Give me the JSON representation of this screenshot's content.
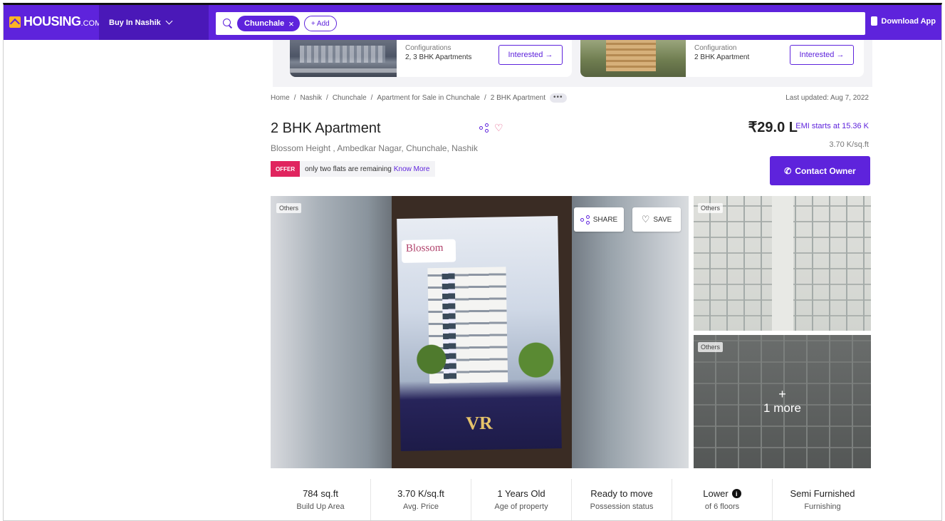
{
  "topbar": {
    "logo_text": "HOUSING",
    "logo_suffix": ".COM",
    "city_button": "Buy In Nashik",
    "search_chip": "Chunchale",
    "chip_close": "×",
    "add_button": "+ Add",
    "download_app": "Download App"
  },
  "similar_projects": [
    {
      "config_label": "Configurations",
      "config_value": "2, 3 BHK Apartments",
      "button": "Interested →"
    },
    {
      "config_label": "Configuration",
      "config_value": "2 BHK Apartment",
      "button": "Interested →"
    }
  ],
  "breadcrumb": {
    "items": [
      "Home",
      "Nashik",
      "Chunchale",
      "Apartment for Sale in Chunchale",
      "2 BHK Apartment"
    ],
    "separator": "/",
    "more": "•••"
  },
  "last_updated": "Last updated: Aug 7, 2022",
  "listing": {
    "title": "2 BHK Apartment",
    "address": "Blossom Height , Ambedkar Nagar, Chunchale, Nashik",
    "offer_badge": "OFFER",
    "offer_text": "only two flats are remaining",
    "offer_link": "Know More",
    "price": "₹29.0 L",
    "emi_prefix": "EMI starts at",
    "emi_value": "15.36 K",
    "price_per_sqft": "3.70 K/sq.ft",
    "contact_button": "Contact Owner"
  },
  "gallery": {
    "main_tag": "Others",
    "share_button": "SHARE",
    "save_button": "SAVE",
    "brochure_logo": "Blossom",
    "brochure_brand": "VR",
    "side_tags": [
      "Others",
      "Others"
    ],
    "more_plus": "+",
    "more_label": "1 more"
  },
  "stats": [
    {
      "value": "784 sq.ft",
      "label": "Build Up Area"
    },
    {
      "value": "3.70 K/sq.ft",
      "label": "Avg. Price"
    },
    {
      "value": "1 Years Old",
      "label": "Age of property"
    },
    {
      "value": "Ready to move",
      "label": "Possession status"
    },
    {
      "value": "Lower",
      "label": "of 6 floors",
      "info_icon": "i"
    },
    {
      "value": "Semi Furnished",
      "label": "Furnishing"
    }
  ],
  "colors": {
    "brand": "#5e23dc",
    "brand_dark": "#4a18b8",
    "logo_accent": "#fcb326",
    "offer": "#e0245e"
  }
}
